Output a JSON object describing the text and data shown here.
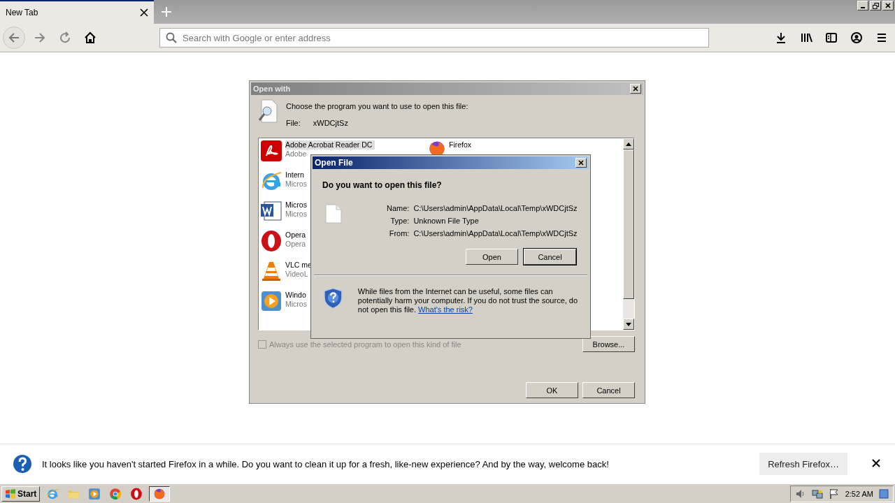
{
  "browser": {
    "tabs": [
      {
        "title": "New Tab",
        "selected": true
      }
    ],
    "address_bar": {
      "placeholder": "Search with Google or enter address"
    }
  },
  "open_with": {
    "title": "Open with",
    "prompt": "Choose the program you want to use to open this file:",
    "file_label": "File:",
    "file_name": "xWDCjtSz",
    "programs": [
      {
        "kind": "pdf",
        "name": "Adobe Acrobat Reader DC",
        "publisher": "Adobe",
        "selected": true
      },
      {
        "kind": "ie",
        "name": "Intern",
        "publisher": "Micros",
        "selected": false
      },
      {
        "kind": "word",
        "name": "Micros",
        "publisher": "Micros",
        "selected": false
      },
      {
        "kind": "opera",
        "name": "Opera",
        "publisher": "Opera",
        "selected": false
      },
      {
        "kind": "vlc",
        "name": "VLC me",
        "publisher": "VideoL",
        "selected": false
      },
      {
        "kind": "media",
        "name": "Windo",
        "publisher": "Micros",
        "selected": false
      }
    ],
    "other_programs": [
      {
        "kind": "firefox",
        "name": "Firefox",
        "selected": false
      }
    ],
    "always_use": {
      "label": "Always use the selected program to open this kind of file",
      "checked": false,
      "disabled": true
    },
    "buttons": {
      "browse": "Browse...",
      "ok": "OK",
      "cancel": "Cancel"
    }
  },
  "open_file": {
    "title": "Open File",
    "question": "Do you want to open this file?",
    "fields": [
      {
        "label": "Name:",
        "value": "C:\\Users\\admin\\AppData\\Local\\Temp\\xWDCjtSz"
      },
      {
        "label": "Type:",
        "value": "Unknown File Type"
      },
      {
        "label": "From:",
        "value": "C:\\Users\\admin\\AppData\\Local\\Temp\\xWDCjtSz"
      }
    ],
    "buttons": [
      {
        "label": "Open",
        "default": false
      },
      {
        "label": "Cancel",
        "default": true
      }
    ],
    "warning": "While files from the Internet can be useful, some files can potentially harm your computer. If you do not trust the source, do not open this file.",
    "risk_link": "What's the risk?"
  },
  "notification": {
    "message": "It looks like you haven't started Firefox in a while. Do you want to clean it up for a fresh, like-new experience? And by the way, welcome back!",
    "button": "Refresh Firefox…"
  },
  "taskbar": {
    "start": "Start",
    "apps": [
      {
        "kind": "ie",
        "selected": false
      },
      {
        "kind": "folder",
        "selected": false
      },
      {
        "kind": "media",
        "selected": false
      },
      {
        "kind": "chrome",
        "selected": false
      },
      {
        "kind": "opera",
        "selected": false
      },
      {
        "kind": "firefox",
        "selected": true
      }
    ],
    "clock": "2:52 AM"
  }
}
